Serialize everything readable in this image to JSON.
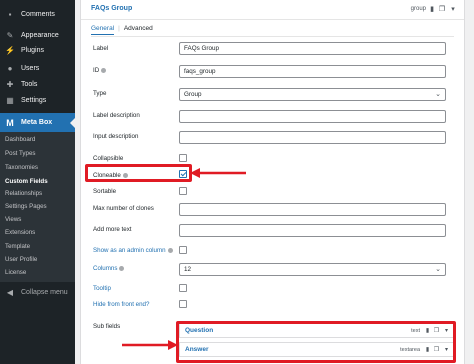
{
  "sidebar": {
    "items": [
      {
        "label": "Comments",
        "icon": "comment-icon"
      },
      {
        "label": "Appearance",
        "icon": "brush-icon"
      },
      {
        "label": "Plugins",
        "icon": "plugin-icon"
      },
      {
        "label": "Users",
        "icon": "users-icon"
      },
      {
        "label": "Tools",
        "icon": "wrench-icon"
      },
      {
        "label": "Settings",
        "icon": "settings-icon"
      },
      {
        "label": "Meta Box",
        "icon": "metabox-logo-icon"
      }
    ],
    "submenu": [
      "Dashboard",
      "Post Types",
      "Taxonomies",
      "Custom Fields",
      "Relationships",
      "Settings Pages",
      "Views",
      "Extensions",
      "Template",
      "User Profile",
      "License"
    ],
    "collapse_label": "Collapse menu"
  },
  "group": {
    "title": "FAQs Group",
    "type": "group",
    "tabs": [
      "General",
      "Advanced"
    ]
  },
  "fields": {
    "label": {
      "label": "Label",
      "value": "FAQs Group"
    },
    "id": {
      "label": "ID",
      "value": "faqs_group"
    },
    "type": {
      "label": "Type",
      "value": "Group"
    },
    "label_description": {
      "label": "Label description",
      "value": ""
    },
    "input_description": {
      "label": "Input description",
      "value": ""
    },
    "collapsible": {
      "label": "Collapsible",
      "checked": false
    },
    "cloneable": {
      "label": "Cloneable",
      "checked": true
    },
    "sortable": {
      "label": "Sortable",
      "checked": false
    },
    "max_clones": {
      "label": "Max number of clones",
      "value": ""
    },
    "add_more_text": {
      "label": "Add more text",
      "value": ""
    },
    "admin_column": {
      "label": "Show as an admin column",
      "checked": false
    },
    "columns": {
      "label": "Columns",
      "value": "12"
    },
    "tooltip": {
      "label": "Tooltip",
      "checked": false
    },
    "hide_front": {
      "label": "Hide from front end?",
      "checked": false
    },
    "sub_fields_label": "Sub fields"
  },
  "sub_fields": [
    {
      "title": "Question",
      "type": "text"
    },
    {
      "title": "Answer",
      "type": "textarea"
    }
  ],
  "colors": {
    "accent": "#2271b1",
    "annotation": "#e01b24",
    "sidebar_bg": "#1d2327"
  }
}
